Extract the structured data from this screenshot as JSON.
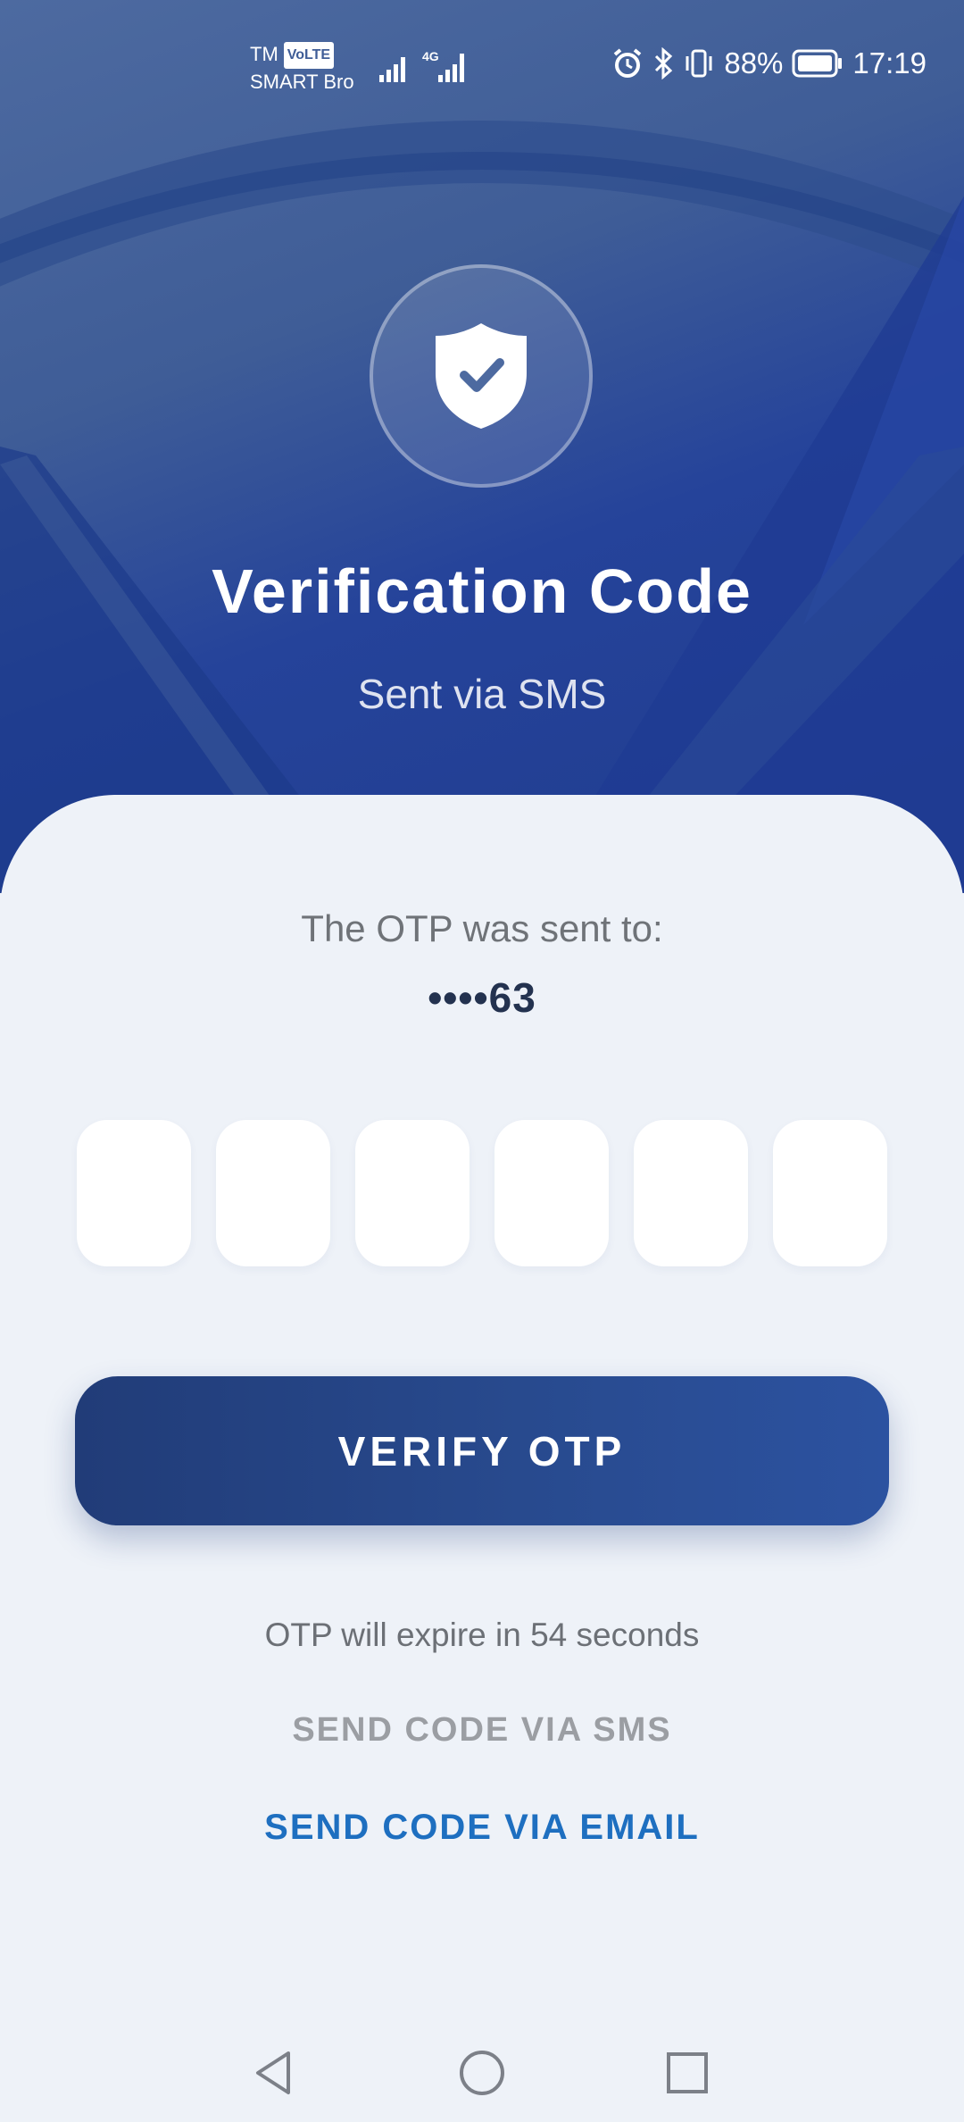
{
  "status_bar": {
    "carrier_line1": "TM",
    "volte": "VoLTE",
    "carrier_line2": "SMART Bro",
    "network": "4G",
    "battery": "88%",
    "time": "17:19",
    "icons": [
      "signal-icon",
      "alarm-icon",
      "bluetooth-icon",
      "vibrate-icon",
      "battery-icon"
    ]
  },
  "hero": {
    "icon": "shield-check-icon",
    "title": "Verification Code",
    "subtitle": "Sent via SMS"
  },
  "otp": {
    "sent_to_label": "The OTP was sent to:",
    "masked_number": "••••63",
    "digits": [
      "",
      "",
      "",
      "",
      "",
      ""
    ]
  },
  "actions": {
    "verify_label": "VERIFY OTP",
    "expire_text": "OTP will expire in 54 seconds",
    "send_sms_label": "SEND CODE VIA SMS",
    "send_email_label": "SEND CODE VIA EMAIL"
  },
  "nav": {
    "icons": [
      "back-icon",
      "home-icon",
      "recents-icon"
    ]
  },
  "colors": {
    "primary": "#23418a",
    "link": "#1e6fc0",
    "disabled": "#9b9ea3",
    "background": "#eef2f8"
  }
}
